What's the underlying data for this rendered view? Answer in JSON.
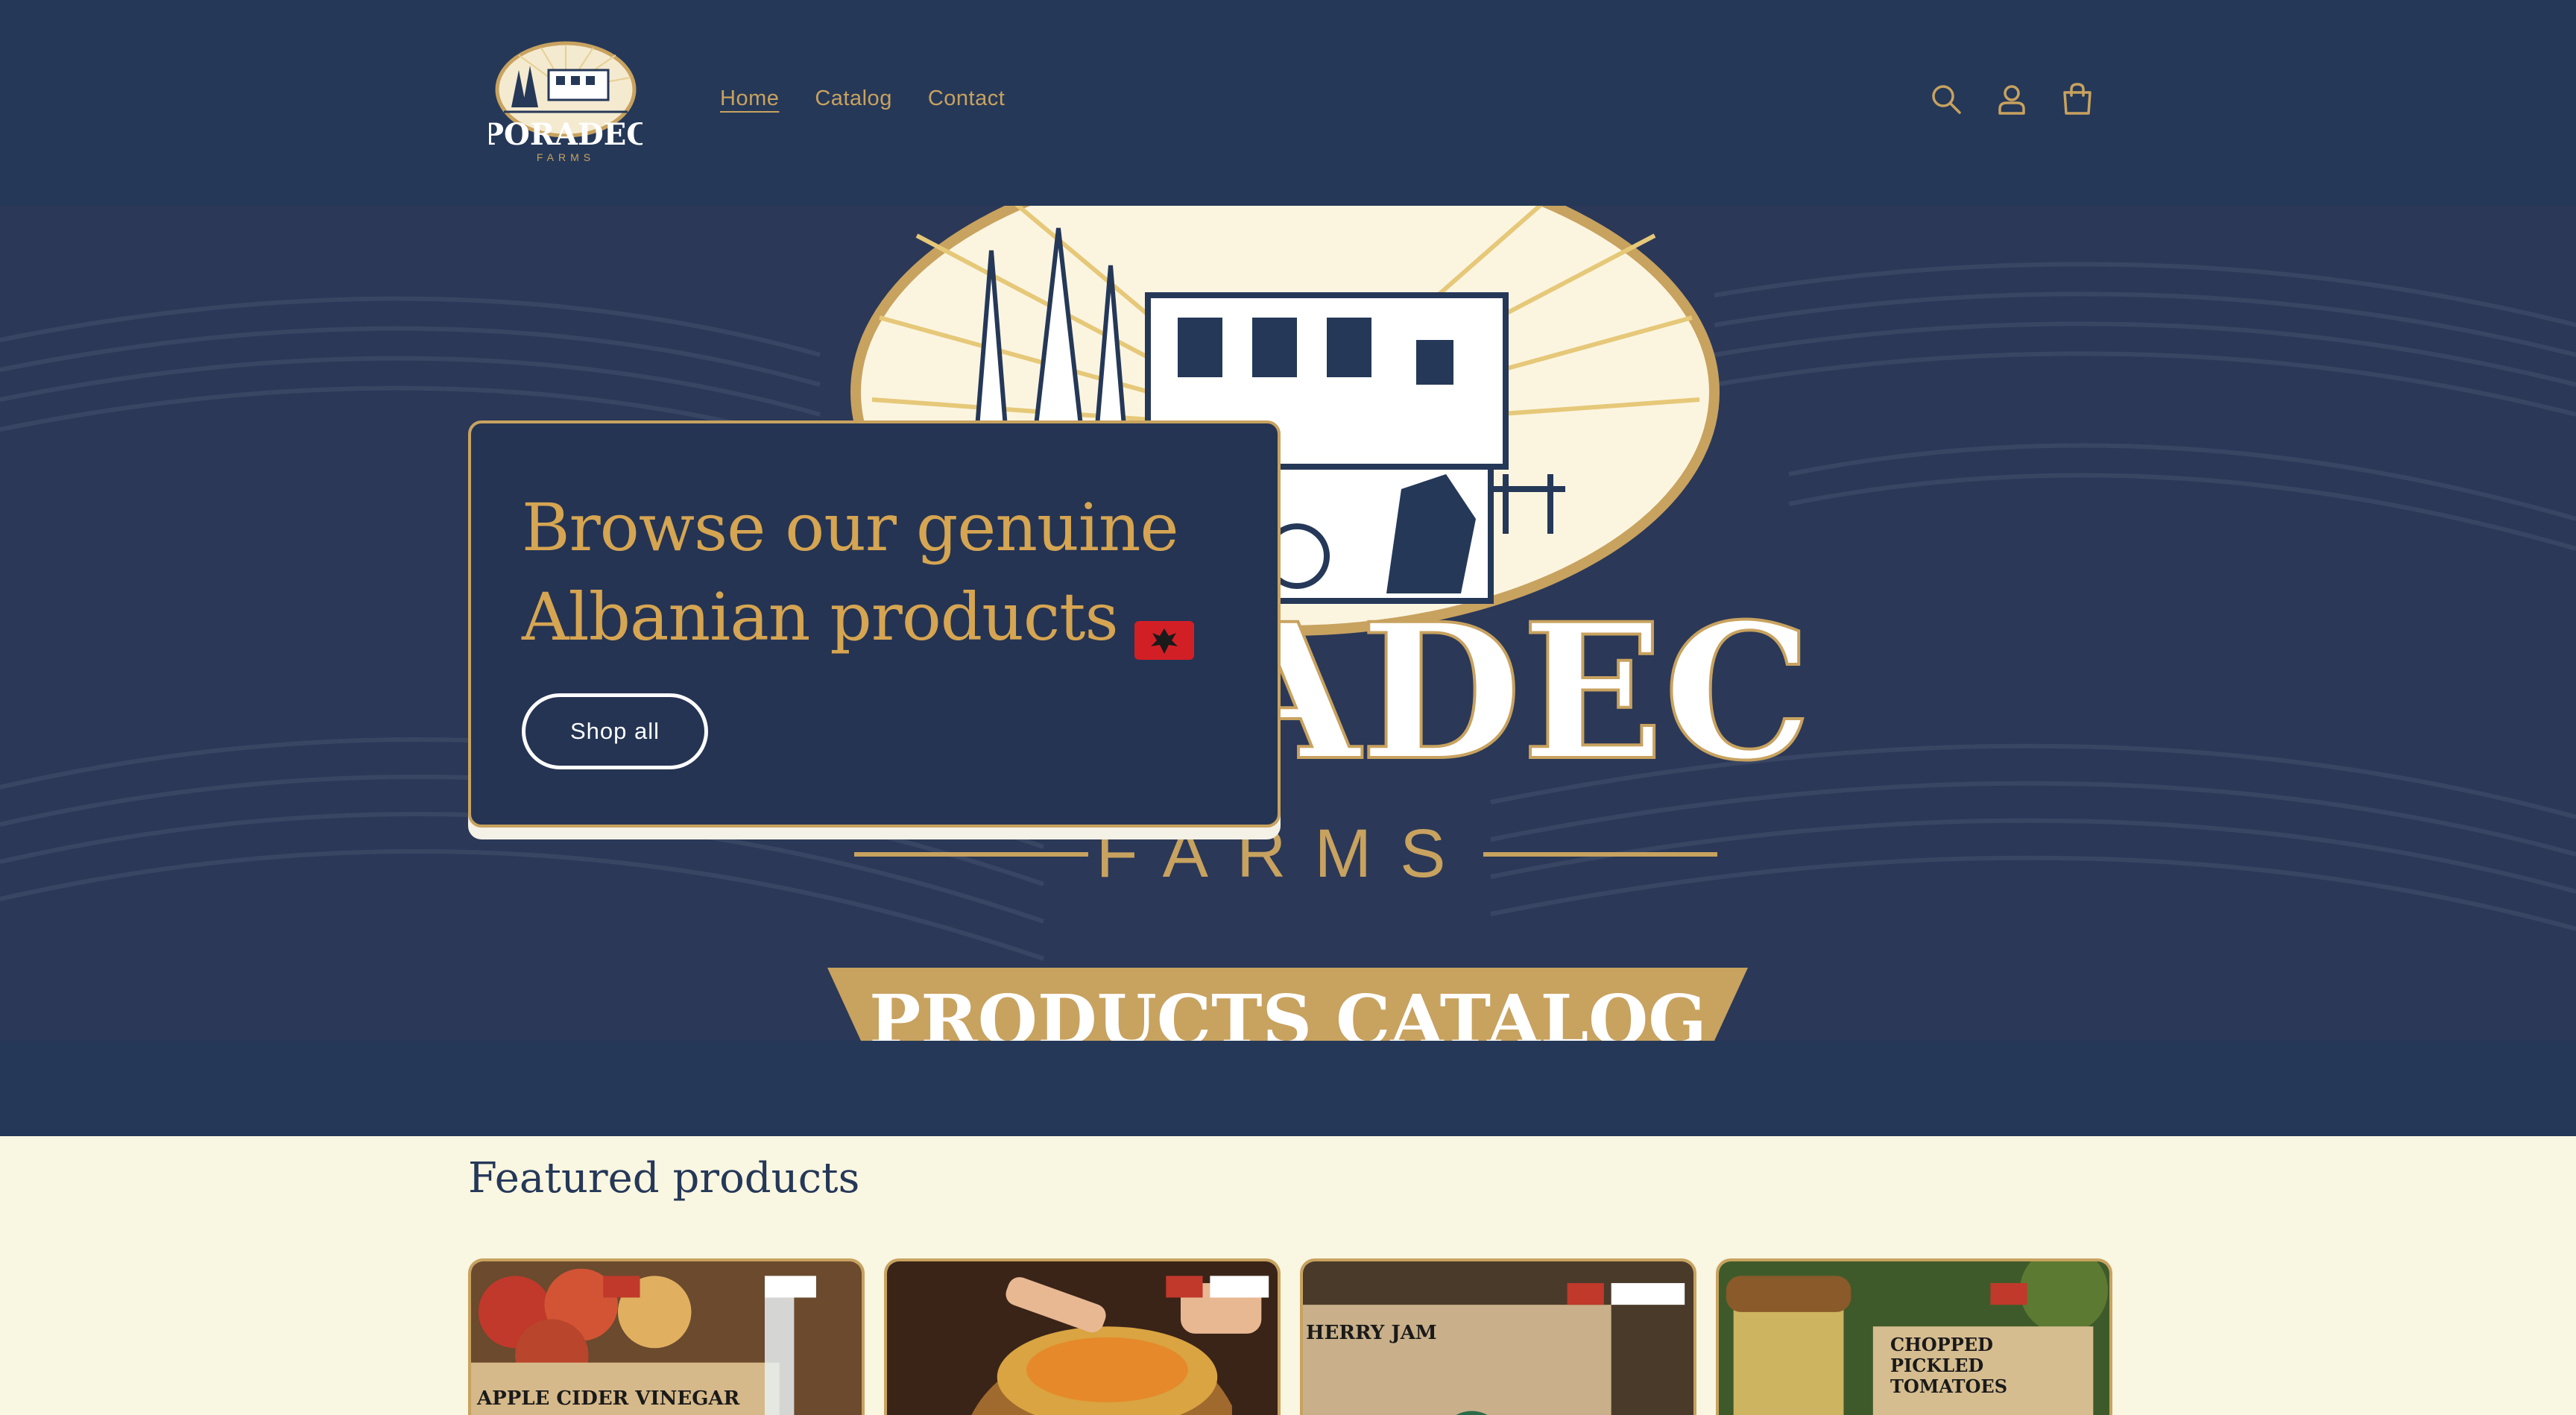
{
  "header": {
    "logo_text": "PORADEC",
    "logo_subtext": "FARMS",
    "nav": [
      {
        "label": "Home",
        "active": true
      },
      {
        "label": "Catalog",
        "active": false
      },
      {
        "label": "Contact",
        "active": false
      }
    ],
    "icons": [
      "search-icon",
      "account-icon",
      "cart-icon"
    ]
  },
  "hero": {
    "heading_line1": "Browse our genuine",
    "heading_line2": "Albanian products",
    "flag": "albania-flag-icon",
    "button_label": "Shop all",
    "background_title": "PORADEC",
    "background_subtitle": "FARMS",
    "banner_text": "PRODUCTS CATALOG"
  },
  "featured": {
    "title": "Featured products",
    "products": [
      {
        "label": "APPLE CIDER VINEGAR"
      },
      {
        "label": ""
      },
      {
        "label": "HERRY JAM"
      },
      {
        "label": "CHOPPED PICKLED TOMATOES"
      }
    ]
  },
  "colors": {
    "navy": "#253858",
    "gold": "#c8a25f",
    "cream": "#f9f6e1"
  }
}
